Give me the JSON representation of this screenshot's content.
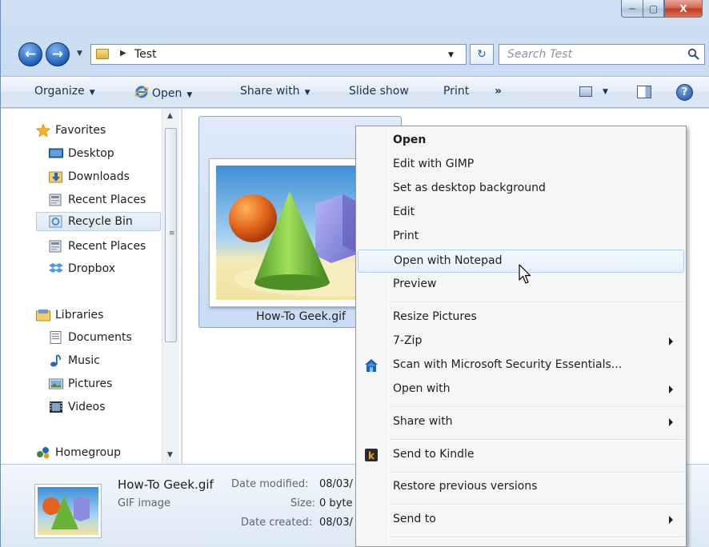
{
  "window": {
    "caption_buttons": {
      "minimize": "─",
      "maximize": "▢",
      "close": "X"
    }
  },
  "address_bar": {
    "breadcrumb": "Test",
    "search_placeholder": "Search Test",
    "back_glyph": "←",
    "forward_glyph": "→",
    "refresh_glyph": "↻"
  },
  "command_bar": {
    "organize": "Organize",
    "open": "Open",
    "share_with": "Share with",
    "slide_show": "Slide show",
    "print": "Print",
    "more": "»",
    "help": "?"
  },
  "nav_pane": {
    "favorites": [
      {
        "label": "Favorites",
        "icon": "star-icon"
      },
      {
        "label": "Desktop",
        "icon": "desktop-icon"
      },
      {
        "label": "Downloads",
        "icon": "downloads-icon"
      },
      {
        "label": "Recent Places",
        "icon": "recent-places-icon"
      },
      {
        "label": "Recycle Bin",
        "icon": "recycle-bin-icon"
      },
      {
        "label": "Recent Places",
        "icon": "recent-places-icon"
      },
      {
        "label": "Dropbox",
        "icon": "dropbox-icon"
      }
    ],
    "libraries": [
      {
        "label": "Libraries",
        "icon": "libraries-icon"
      },
      {
        "label": "Documents",
        "icon": "documents-icon"
      },
      {
        "label": "Music",
        "icon": "music-icon"
      },
      {
        "label": "Pictures",
        "icon": "pictures-icon"
      },
      {
        "label": "Videos",
        "icon": "videos-icon"
      }
    ],
    "homegroup": {
      "label": "Homegroup",
      "icon": "homegroup-icon"
    }
  },
  "content": {
    "file_name": "How-To Geek.gif"
  },
  "details": {
    "name": "How-To Geek.gif",
    "type": "GIF image",
    "date_modified_label": "Date modified:",
    "date_modified_value": "08/03/",
    "size_label": "Size:",
    "size_value": "0 byte",
    "date_created_label": "Date created:",
    "date_created_value": "08/03/"
  },
  "context_menu": {
    "items": [
      {
        "label": "Open",
        "bold": true
      },
      {
        "label": "Edit with GIMP"
      },
      {
        "label": "Set as desktop background"
      },
      {
        "label": "Edit"
      },
      {
        "label": "Print"
      },
      {
        "label": "Open with Notepad",
        "hover": true
      },
      {
        "label": "Preview"
      },
      {
        "label": "Resize Pictures"
      },
      {
        "label": "7-Zip",
        "submenu": true
      },
      {
        "label": "Scan with Microsoft Security Essentials...",
        "icon": "security-essentials-icon"
      },
      {
        "label": "Open with",
        "submenu": true
      },
      {
        "label": "Share with",
        "submenu": true
      },
      {
        "label": "Send to Kindle",
        "icon": "kindle-icon"
      },
      {
        "label": "Restore previous versions"
      },
      {
        "label": "Send to",
        "submenu": true
      }
    ]
  },
  "colors": {
    "window_frame": "#bcd3ee",
    "selection": "#c9dcf5",
    "menu_hover_border": "#aecff7"
  }
}
